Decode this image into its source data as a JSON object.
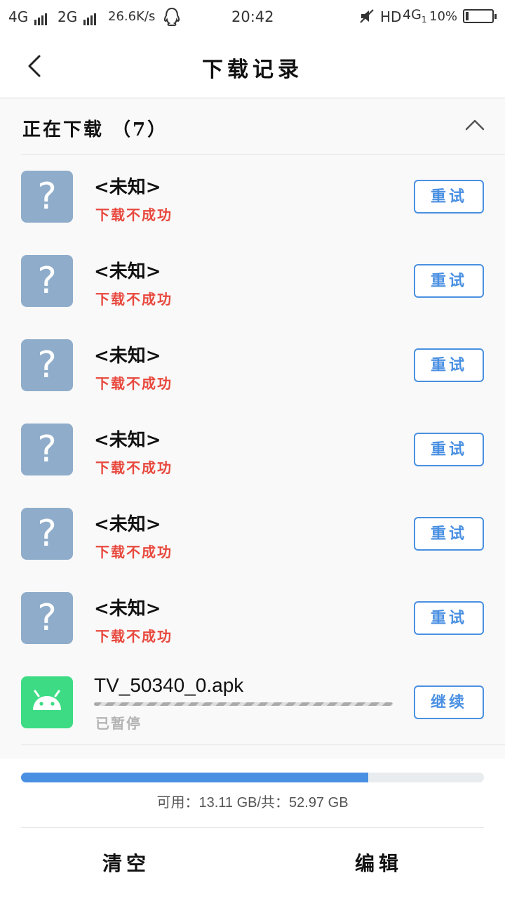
{
  "status_bar": {
    "network1": "4G",
    "network2": "2G",
    "speed": "26.6K/s",
    "time": "20:42",
    "hd": "HD",
    "network3": "4G",
    "network3_sub": "1",
    "battery": "10%",
    "battery_level": 0.1
  },
  "header": {
    "title": "下载记录"
  },
  "section": {
    "title": "正在下载 （7）"
  },
  "items": [
    {
      "name": "<未知>",
      "status": "下载不成功",
      "action": "重试",
      "icon": "question-mark-icon"
    },
    {
      "name": "<未知>",
      "status": "下载不成功",
      "action": "重试",
      "icon": "question-mark-icon"
    },
    {
      "name": "<未知>",
      "status": "下载不成功",
      "action": "重试",
      "icon": "question-mark-icon"
    },
    {
      "name": "<未知>",
      "status": "下载不成功",
      "action": "重试",
      "icon": "question-mark-icon"
    },
    {
      "name": "<未知>",
      "status": "下载不成功",
      "action": "重试",
      "icon": "question-mark-icon"
    },
    {
      "name": "<未知>",
      "status": "下载不成功",
      "action": "重试",
      "icon": "question-mark-icon"
    },
    {
      "name": "TV_50340_0.apk",
      "status": "已暂停",
      "action": "继续",
      "icon": "android-icon"
    }
  ],
  "storage": {
    "text": "可用：13.11 GB/共：52.97 GB",
    "used_fraction": 0.75
  },
  "footer": {
    "clear_label": "清空",
    "edit_label": "编辑"
  },
  "colors": {
    "accent": "#4a90e2",
    "error": "#e8493e",
    "unknown_icon": "#8fadca",
    "android_icon": "#3ddc84"
  }
}
